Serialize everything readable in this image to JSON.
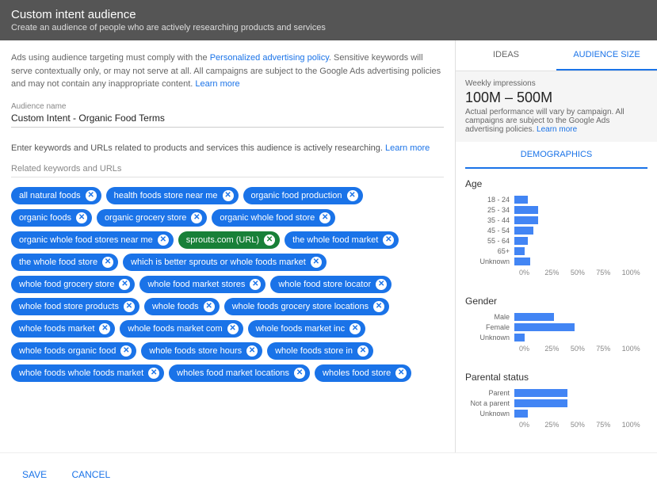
{
  "header": {
    "title": "Custom intent audience",
    "subtitle": "Create an audience of people who are actively researching products and services"
  },
  "policy": {
    "text1": "Ads using audience targeting must comply with the ",
    "link1": "Personalized advertising policy",
    "text2": ". Sensitive keywords will serve contextually only, or may not serve at all. All campaigns are subject to the Google Ads advertising policies and may not contain any inappropriate content. ",
    "link2": "Learn more"
  },
  "audience_name": {
    "label": "Audience name",
    "value": "Custom Intent - Organic Food Terms"
  },
  "instruct": {
    "text": "Enter keywords and URLs related to products and services this audience is actively researching. ",
    "link": "Learn more"
  },
  "related_label": "Related keywords and URLs",
  "chips": [
    {
      "label": "all natural foods",
      "type": "kw"
    },
    {
      "label": "health foods store near me",
      "type": "kw"
    },
    {
      "label": "organic food production",
      "type": "kw"
    },
    {
      "label": "organic foods",
      "type": "kw"
    },
    {
      "label": "organic grocery store",
      "type": "kw"
    },
    {
      "label": "organic whole food store",
      "type": "kw"
    },
    {
      "label": "organic whole food stores near me",
      "type": "kw"
    },
    {
      "label": "sprouts.com (URL)",
      "type": "url"
    },
    {
      "label": "the whole food market",
      "type": "kw"
    },
    {
      "label": "the whole food store",
      "type": "kw"
    },
    {
      "label": "which is better sprouts or whole foods market",
      "type": "kw"
    },
    {
      "label": "whole food grocery store",
      "type": "kw"
    },
    {
      "label": "whole food market stores",
      "type": "kw"
    },
    {
      "label": "whole food store locator",
      "type": "kw"
    },
    {
      "label": "whole food store products",
      "type": "kw"
    },
    {
      "label": "whole foods",
      "type": "kw"
    },
    {
      "label": "whole foods grocery store locations",
      "type": "kw"
    },
    {
      "label": "whole foods market",
      "type": "kw"
    },
    {
      "label": "whole foods market com",
      "type": "kw"
    },
    {
      "label": "whole foods market inc",
      "type": "kw"
    },
    {
      "label": "whole foods organic food",
      "type": "kw"
    },
    {
      "label": "whole foods store hours",
      "type": "kw"
    },
    {
      "label": "whole foods store in",
      "type": "kw"
    },
    {
      "label": "whole foods whole foods market",
      "type": "kw"
    },
    {
      "label": "wholes food market locations",
      "type": "kw"
    },
    {
      "label": "wholes food store",
      "type": "kw"
    }
  ],
  "tabs": {
    "ideas": "IDEAS",
    "audience_size": "AUDIENCE SIZE"
  },
  "summary": {
    "label": "Weekly impressions",
    "value": "100M – 500M",
    "note": "Actual performance will vary by campaign. All campaigns are subject to the Google Ads advertising policies. ",
    "link": "Learn more"
  },
  "demographics_label": "DEMOGRAPHICS",
  "axis_labels": [
    "0%",
    "25%",
    "50%",
    "75%",
    "100%"
  ],
  "footer": {
    "save": "SAVE",
    "cancel": "CANCEL"
  },
  "chart_data": [
    {
      "type": "bar",
      "title": "Age",
      "categories": [
        "18 - 24",
        "25 - 34",
        "35 - 44",
        "45 - 54",
        "55 - 64",
        "65+",
        "Unknown"
      ],
      "values": [
        10,
        18,
        18,
        14,
        10,
        8,
        12
      ],
      "xlim": [
        0,
        100
      ]
    },
    {
      "type": "bar",
      "title": "Gender",
      "categories": [
        "Male",
        "Female",
        "Unknown"
      ],
      "values": [
        30,
        45,
        8
      ],
      "xlim": [
        0,
        100
      ]
    },
    {
      "type": "bar",
      "title": "Parental status",
      "categories": [
        "Parent",
        "Not a parent",
        "Unknown"
      ],
      "values": [
        40,
        40,
        10
      ],
      "xlim": [
        0,
        100
      ]
    }
  ]
}
